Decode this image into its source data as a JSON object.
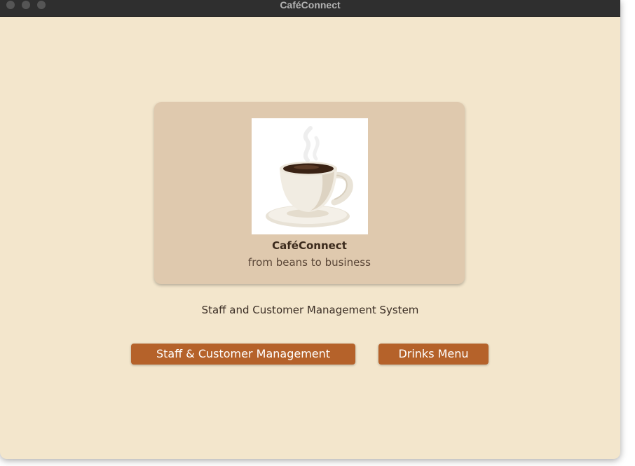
{
  "window": {
    "title": "CaféConnect"
  },
  "brand": {
    "name": "CaféConnect",
    "tagline": "from beans to business",
    "logo_icon": "coffee-cup-icon"
  },
  "main": {
    "subtitle": "Staff and Customer Management System"
  },
  "buttons": {
    "staff_customer": "Staff & Customer Management",
    "drinks_menu": "Drinks Menu"
  },
  "colors": {
    "background": "#f3e6cc",
    "card": "#dfc9ae",
    "button": "#b5622a",
    "titlebar": "#2f2f2f"
  }
}
